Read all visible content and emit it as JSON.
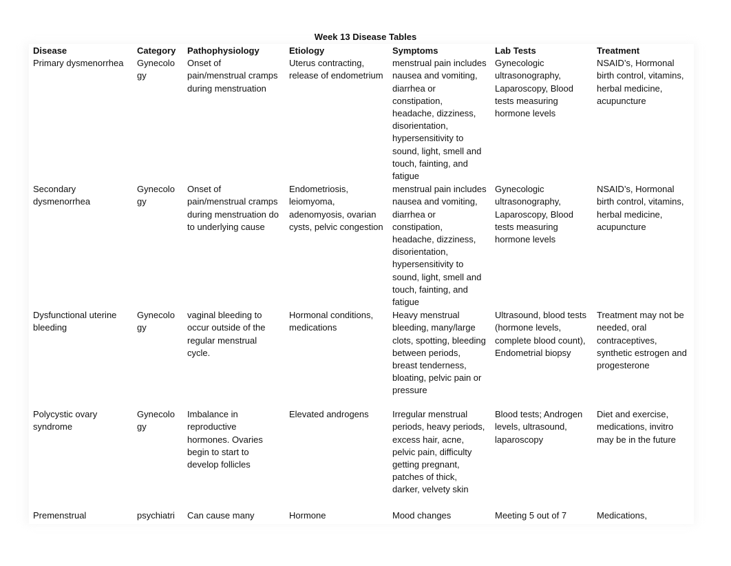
{
  "document": {
    "title": "Week 13 Disease Tables"
  },
  "table": {
    "headers": [
      "Disease",
      "Category",
      "Pathophysiology",
      "Etiology",
      "Symptoms",
      "Lab Tests",
      "Treatment"
    ],
    "rows": [
      {
        "disease": "Primary dysmenorrhea",
        "category": "Gynecology",
        "pathophysiology": "Onset of pain/menstrual cramps during menstruation",
        "etiology": "Uterus contracting, release of endometrium",
        "symptoms": "menstrual pain includes nausea and vomiting, diarrhea or constipation, headache, dizziness, disorientation, hypersensitivity to sound, light, smell and touch, fainting, and fatigue",
        "lab_tests": "Gynecologic ultrasonography, Laparoscopy, Blood tests measuring hormone levels",
        "treatment": "NSAID’s, Hormonal birth control, vitamins, herbal medicine, acupuncture"
      },
      {
        "disease": "Secondary dysmenorrhea",
        "category": "Gynecology",
        "pathophysiology": "Onset of pain/menstrual cramps during menstruation do to underlying cause",
        "etiology": "Endometriosis, leiomyoma, adenomyosis, ovarian cysts, pelvic congestion",
        "symptoms": "menstrual pain includes nausea and vomiting, diarrhea or constipation, headache, dizziness, disorientation, hypersensitivity to sound, light, smell and touch, fainting, and fatigue",
        "lab_tests": "Gynecologic ultrasonography, Laparoscopy, Blood tests measuring hormone levels",
        "treatment": "NSAID’s, Hormonal birth control, vitamins, herbal medicine, acupuncture"
      },
      {
        "disease": "Dysfunctional uterine bleeding",
        "category": "Gynecology",
        "pathophysiology": "vaginal bleeding to occur outside of the regular menstrual cycle.",
        "etiology": "Hormonal conditions, medications",
        "symptoms": "Heavy menstrual bleeding, many/large clots, spotting, bleeding between periods, breast tenderness, bloating, pelvic pain or pressure",
        "lab_tests": "Ultrasound, blood tests (hormone levels, complete blood count), Endometrial biopsy",
        "treatment": "Treatment may not be needed, oral contraceptives, synthetic estrogen and progesterone"
      },
      {
        "disease": "Polycystic ovary syndrome",
        "category": "Gynecology",
        "pathophysiology": "Imbalance in reproductive hormones. Ovaries begin to start to develop follicles",
        "etiology": "Elevated androgens",
        "symptoms": "Irregular menstrual periods, heavy periods, excess hair, acne, pelvic pain, difficulty getting pregnant, patches of thick, darker, velvety skin",
        "lab_tests": "Blood tests; Androgen levels, ultrasound, laparoscopy",
        "treatment": "Diet and exercise, medications, invitro may be in the future"
      },
      {
        "disease": "Premenstrual",
        "category": "psychiatri",
        "pathophysiology": "Can cause many",
        "etiology": "Hormone",
        "symptoms": "Mood changes",
        "lab_tests": "Meeting 5 out of 7",
        "treatment": "Medications,"
      }
    ]
  }
}
